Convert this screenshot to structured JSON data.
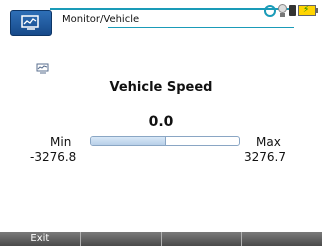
{
  "header": {
    "breadcrumb": "Monitor/Vehicle",
    "app_icon": "monitor-icon",
    "status_icons": [
      "refresh-icon",
      "lightbulb-icon",
      "sdcard-icon",
      "battery-icon"
    ]
  },
  "main": {
    "title": "Vehicle Speed",
    "value": "0.0",
    "level_fraction": 0.5,
    "min_label": "Min",
    "min_value": "-3276.8",
    "max_label": "Max",
    "max_value": "3276.7"
  },
  "footer": {
    "softkeys": [
      "Exit",
      "",
      "",
      ""
    ]
  },
  "colors": {
    "accent": "#1a9bb8",
    "icon_blue": "#1f5ea8",
    "footer_gray": "#5a5a5a",
    "battery_yellow": "#ffd400"
  }
}
